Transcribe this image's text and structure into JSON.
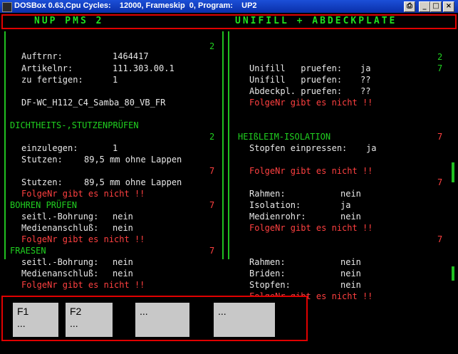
{
  "window": {
    "title": "DOSBox 0.63,Cpu Cycles:    12000, Frameskip  0, Program:    UP2",
    "buttons": {
      "snap": "⎙",
      "minimize": "_",
      "maximize": "□",
      "close": "×"
    }
  },
  "header": {
    "left": "NUP PMS 2",
    "right": "UNIFILL + ABDECKPLATE"
  },
  "left": {
    "step_no": "2",
    "auftrnr_label": "Auftrnr:",
    "auftrnr_value": "1464417",
    "artikelnr_label": "Artikelnr:",
    "artikelnr_value": "111.303.00.1",
    "zu_fertigen_label": "zu fertigen:",
    "zu_fertigen_value": "1",
    "article_code": "DF-WC_H112_C4_Samba_80_VB_FR",
    "section1_title": "DICHTHEITS-,STUTZENPRÜFEN",
    "section1_no": "2",
    "einzulegen_label": "einzulegen:",
    "einzulegen_value": "1",
    "stutzen1_label": "Stutzen:",
    "stutzen1_value": "89,5 mm ohne Lappen",
    "no7_a": "7",
    "stutzen2_label": "Stutzen:",
    "stutzen2_value": "89,5 mm ohne Lappen",
    "folge1": "FolgeNr gibt es nicht !!",
    "section2_title": "BOHREN PRÜFEN",
    "section2_no": "7",
    "seitl1_label": "seitl.-Bohrung:",
    "seitl1_value": "nein",
    "medien1_label": "Medienanschluß:",
    "medien1_value": "nein",
    "folge2": "FolgeNr gibt es nicht !!",
    "section3_title": "FRAESEN",
    "section3_no": "7",
    "seitl2_label": "seitl.-Bohrung:",
    "seitl2_value": "nein",
    "medien2_label": "Medienanschluß:",
    "medien2_value": "nein",
    "folge3": "FolgeNr gibt es nicht !!"
  },
  "right": {
    "no2": "2",
    "unifill1_label": "Unifill   pruefen:",
    "unifill1_value": "ja",
    "no7_1": "7",
    "unifill2_label": "Unifill   pruefen:",
    "unifill2_value": "??",
    "abdeck_label": "Abdeckpl. pruefen:",
    "abdeck_value": "??",
    "folge1": "FolgeNr gibt es nicht !!",
    "section_title": "HEIßLEIM-ISOLATION",
    "section_no": "7",
    "stopfen_label": "Stopfen einpressen:",
    "stopfen_value": "ja",
    "folge2": "FolgeNr gibt es nicht !!",
    "no7_2": "7",
    "rahmen1_label": "Rahmen:",
    "rahmen1_value": "nein",
    "isolation_label": "Isolation:",
    "isolation_value": "ja",
    "medienrohr_label": "Medienrohr:",
    "medienrohr_value": "nein",
    "folge3": "FolgeNr gibt es nicht !!",
    "no7_3": "7",
    "rahmen2_label": "Rahmen:",
    "rahmen2_value": "nein",
    "briden_label": "Briden:",
    "briden_value": "nein",
    "stopfen2_label": "Stopfen:",
    "stopfen2_value": "nein",
    "folge4": "FolgeNr gibt es nicht !!"
  },
  "fkeys": [
    {
      "key": "F1",
      "label": "..."
    },
    {
      "key": "F2",
      "label": "..."
    },
    {
      "key": "",
      "label": "..."
    },
    {
      "key": "",
      "label": "..."
    }
  ],
  "colors": {
    "accent_green": "#20d020",
    "alert_red": "#ff4040",
    "title_blue": "#1c4fd8",
    "border_red": "#e00000"
  }
}
